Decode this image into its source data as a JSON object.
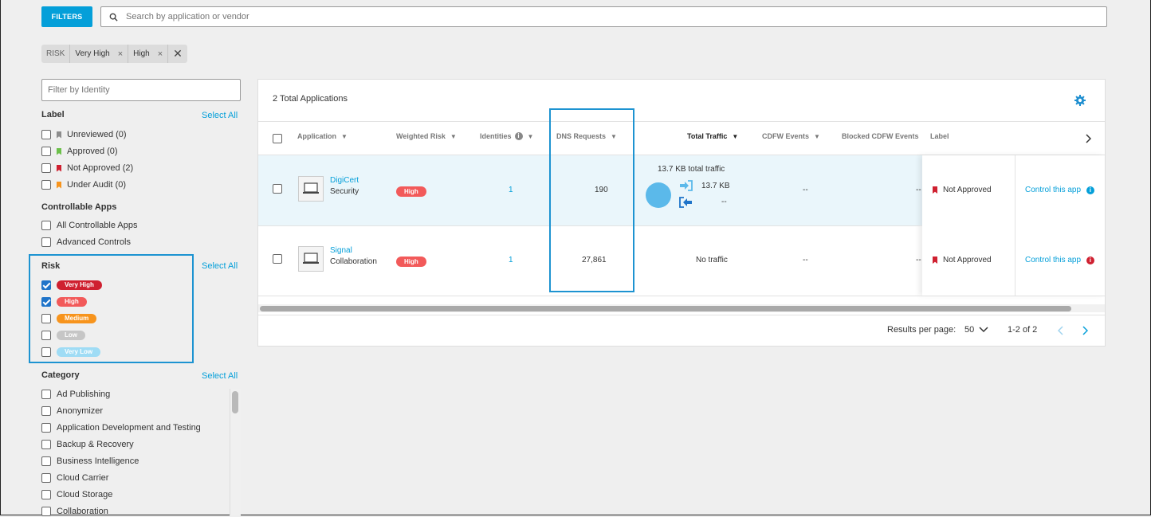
{
  "toolbar": {
    "filters_label": "FILTERS",
    "search_placeholder": "Search by application or vendor"
  },
  "active_filters": {
    "group_label": "RISK",
    "chips": [
      "Very High",
      "High"
    ]
  },
  "sidebar": {
    "identity_placeholder": "Filter by Identity",
    "select_all": "Select All",
    "label_section": {
      "title": "Label",
      "items": [
        {
          "label": "Unreviewed (0)",
          "flag_color": "#8c8c8c"
        },
        {
          "label": "Approved (0)",
          "flag_color": "#6cc04a"
        },
        {
          "label": "Not Approved (2)",
          "flag_color": "#cf2030"
        },
        {
          "label": "Under Audit (0)",
          "flag_color": "#f7941d"
        }
      ]
    },
    "controllable_section": {
      "title": "Controllable Apps",
      "items": [
        "All Controllable Apps",
        "Advanced Controls"
      ]
    },
    "risk_section": {
      "title": "Risk",
      "items": [
        {
          "label": "Very High",
          "checked": true,
          "color": "#cf2030"
        },
        {
          "label": "High",
          "checked": true,
          "color": "#f25a5a"
        },
        {
          "label": "Medium",
          "checked": false,
          "color": "#f7941d"
        },
        {
          "label": "Low",
          "checked": false,
          "color": "#c6c6c6"
        },
        {
          "label": "Very Low",
          "checked": false,
          "color": "#9fdcf5"
        }
      ]
    },
    "category_section": {
      "title": "Category",
      "items": [
        "Ad Publishing",
        "Anonymizer",
        "Application Development and Testing",
        "Backup & Recovery",
        "Business Intelligence",
        "Cloud Carrier",
        "Cloud Storage",
        "Collaboration"
      ]
    }
  },
  "table": {
    "total_label": "2 Total Applications",
    "columns": [
      "Application",
      "Weighted Risk",
      "Identities",
      "DNS Requests",
      "Total Traffic",
      "CDFW Events",
      "Blocked CDFW Events",
      "Label"
    ],
    "rows": [
      {
        "app_name": "DigiCert",
        "category": "Security",
        "risk": "High",
        "identities": "1",
        "dns_requests": "190",
        "traffic_summary": "13.7 KB total traffic",
        "traffic_in": "13.7 KB",
        "traffic_out": "--",
        "cdfw_events": "--",
        "blocked_cdfw": "--",
        "label": "Not Approved",
        "action": "Control this app",
        "info_color": "#049fd9"
      },
      {
        "app_name": "Signal",
        "category": "Collaboration",
        "risk": "High",
        "identities": "1",
        "dns_requests": "27,861",
        "traffic_summary": "No traffic",
        "cdfw_events": "--",
        "blocked_cdfw": "--",
        "label": "Not Approved",
        "action": "Control this app",
        "info_color": "#cf2030"
      }
    ]
  },
  "pagination": {
    "per_page_label": "Results per page:",
    "per_page_value": "50",
    "range": "1-2 of 2"
  },
  "colors": {
    "accent": "#049fd9",
    "highlight_box": "#1d93d1"
  }
}
